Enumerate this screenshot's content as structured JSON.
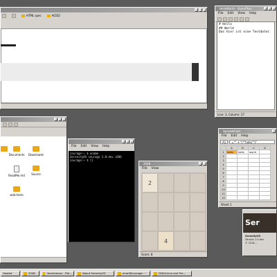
{
  "browser": {
    "bookmarks": [
      "HTML spec",
      "ACID2"
    ]
  },
  "editor": {
    "title": "HelloWorld - StyledText",
    "menu": [
      "File",
      "Edit",
      "View",
      "Help"
    ],
    "lines": [
      "# Hello",
      "## World",
      "Das hier ist eine Testdatei"
    ],
    "status": "Line: 3, Column: 27"
  },
  "files": {
    "items": [
      {
        "label": "Documents",
        "kind": "folder"
      },
      {
        "label": "Downloads",
        "kind": "folder"
      },
      {
        "label": "ReadMe.md",
        "kind": "doc"
      },
      {
        "label": "Source",
        "kind": "folder"
      },
      {
        "label": "web-tests",
        "kind": "folder"
      }
    ]
  },
  "terminal": {
    "title": "Terminal",
    "menu": [
      "File",
      "Edit",
      "View",
      "Help"
    ],
    "lines": [
      "courage:~ $ uname",
      "SerenityOS courage 1.0-dev i686",
      "courage:~ $ []"
    ]
  },
  "game": {
    "title": "2048",
    "menu": [
      "File",
      "View"
    ],
    "tiles": [
      "2",
      "",
      "",
      "",
      "",
      "",
      "",
      "",
      "",
      "",
      "",
      "",
      "",
      "4",
      "",
      ""
    ],
    "score": "Score: 8"
  },
  "sheet": {
    "title": "Spreadsheet",
    "menu": [
      "File",
      "Edit",
      "Help"
    ],
    "cell_ref": "A1",
    "formula": "=\"\" + \"(\"\"hello\"\")\"",
    "cols": [
      "",
      "A",
      "B",
      "C",
      "D"
    ],
    "rows": [
      [
        "1",
        "hello",
        "hello",
        "world",
        ""
      ],
      [
        "2",
        "",
        "",
        "",
        ""
      ],
      [
        "3",
        "",
        "",
        "",
        ""
      ],
      [
        "4",
        "",
        "",
        "",
        ""
      ],
      [
        "5",
        "",
        "",
        "",
        ""
      ],
      [
        "6",
        "",
        "",
        "",
        ""
      ],
      [
        "7",
        "",
        "",
        "",
        ""
      ],
      [
        "8",
        "",
        "",
        "",
        ""
      ],
      [
        "9",
        "",
        "",
        "",
        ""
      ],
      [
        "10",
        "",
        "",
        "",
        ""
      ],
      [
        "11",
        "",
        "",
        "",
        ""
      ],
      [
        "12",
        "",
        "",
        "",
        ""
      ]
    ],
    "tab": "Sheet 1"
  },
  "about": {
    "brand": "Ser",
    "lines": [
      "SerenityOS",
      "Version 1.0-dev",
      "© 2018-..."
    ]
  },
  "taskbar": {
    "items": [
      "Hosted",
      "2048",
      "/home/anon - File...",
      "About SerenityOS",
      "anon@courage: ~",
      "GNU/Linux and Fre..."
    ]
  }
}
